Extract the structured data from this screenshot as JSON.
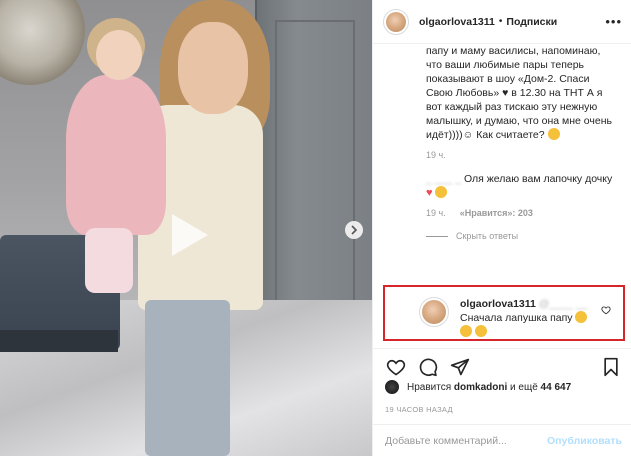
{
  "post": {
    "username": "olgaorlova1311",
    "separator": "•",
    "follow_status": "Подписки",
    "more_icon": "more-horizontal-icon"
  },
  "caption": {
    "text": "папу и маму василисы, напоминаю, что ваши любимые пары теперь показывают в шоу «Дом-2. Спаси Свою Любовь» ♥ в 12.30 на ТНТ А я вот каждый раз тискаю эту нежную малышку, и думаю, что она мне очень идёт))))☺ Как считаете?",
    "time": "19 ч."
  },
  "comment": {
    "username": "_ ___ _",
    "text": "Оля желаю вам лапочку дочку",
    "time": "19 ч.",
    "likes": "«Нравится»: 203",
    "hide_replies": "Скрыть ответы"
  },
  "reply": {
    "username": "olgaorlova1311",
    "mention": "@____ __",
    "text": "Сначала лапушка папу"
  },
  "likes": {
    "prefix": "Нравится",
    "user": "domkadoni",
    "and": "и ещё",
    "count": "44 647"
  },
  "timestamp": "19 ЧАСОВ НАЗАД",
  "add_comment": {
    "placeholder": "Добавьте комментарий...",
    "publish": "Опубликовать"
  },
  "colors": {
    "highlight_border": "#d6262c",
    "heart": "#ed4956",
    "publish_disabled": "#b2dffc"
  }
}
